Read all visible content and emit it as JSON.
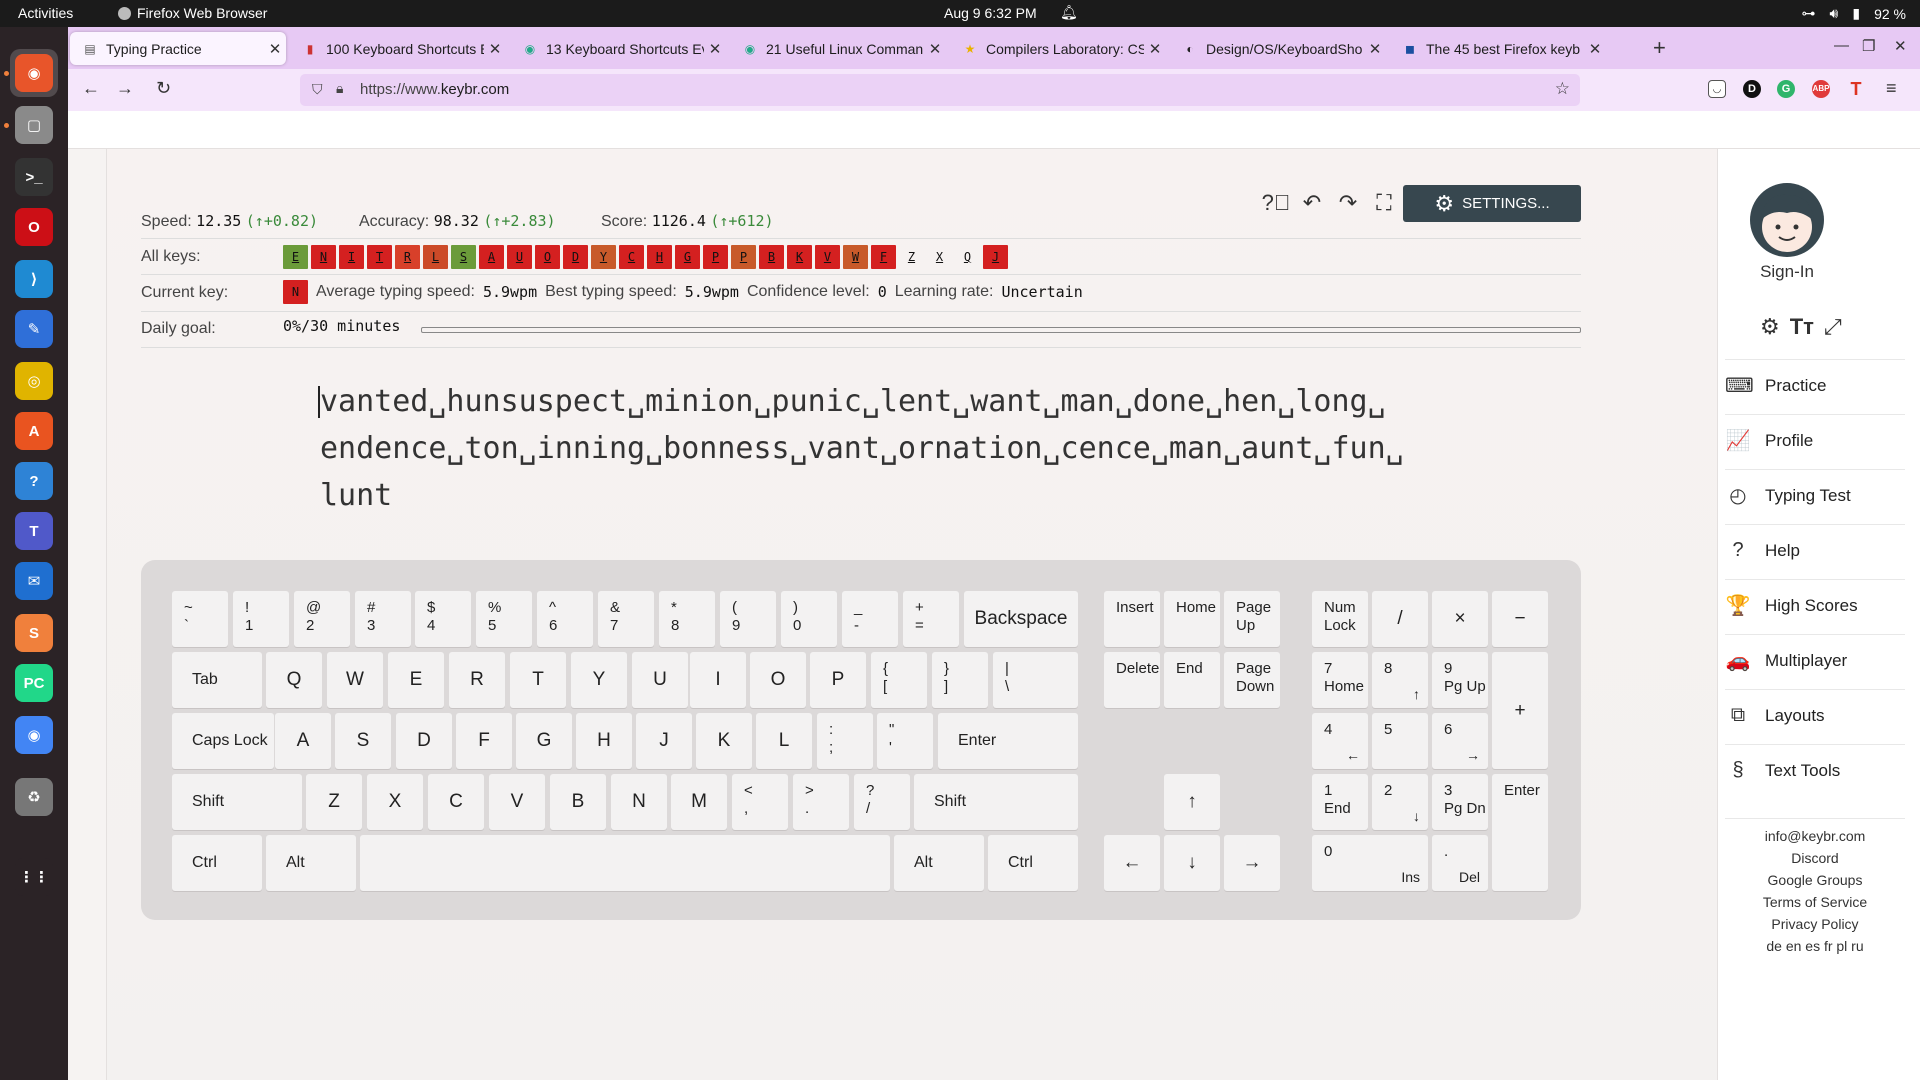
{
  "os": {
    "activities": "Activities",
    "app_name": "Firefox Web Browser",
    "clock": "Aug 9  6:32 PM",
    "battery": "92 %"
  },
  "dock": [
    "firefox-icon",
    "files-icon",
    "terminal-icon",
    "opera-icon",
    "vscode-icon",
    "text-editor-icon",
    "rhythmbox-icon",
    "app-center-icon",
    "help-icon",
    "teams-icon",
    "thunderbird-icon",
    "sublime-icon",
    "pycharm-icon",
    "chrome-icon",
    "trash-icon",
    "app-grid-icon"
  ],
  "tabs": [
    {
      "title": "Typing Practice",
      "favicon": "▤",
      "fav_color": "#555"
    },
    {
      "title": "100 Keyboard Shortcuts E",
      "favicon": "▮",
      "fav_color": "#c33"
    },
    {
      "title": "13 Keyboard Shortcuts Ev",
      "favicon": "◉",
      "fav_color": "#2a8"
    },
    {
      "title": "21 Useful Linux Comman",
      "favicon": "◉",
      "fav_color": "#2a8"
    },
    {
      "title": "Compilers Laboratory: CS",
      "favicon": "★",
      "fav_color": "#e9b200"
    },
    {
      "title": "Design/OS/KeyboardSho",
      "favicon": "◐",
      "fav_color": "#222"
    },
    {
      "title": "The 45 best Firefox keyb",
      "favicon": "◼",
      "fav_color": "#1b4fa0"
    }
  ],
  "url": {
    "prefix": "https://www.",
    "domain": "keybr.com"
  },
  "stats": {
    "speed_label": "Speed:",
    "speed": "12.35",
    "speed_delta": "(↑+0.82)",
    "accuracy_label": "Accuracy:",
    "accuracy": "98.32",
    "accuracy_delta": "(↑+2.83)",
    "score_label": "Score:",
    "score": "1126.4",
    "score_delta": "(↑+612)"
  },
  "settings_label": "SETTINGS...",
  "all_keys_label": "All keys:",
  "all_keys": [
    {
      "k": "E",
      "c": "#6b9b3a"
    },
    {
      "k": "N",
      "c": "#d42020"
    },
    {
      "k": "I",
      "c": "#d42020"
    },
    {
      "k": "T",
      "c": "#d42020"
    },
    {
      "k": "R",
      "c": "#d8402a"
    },
    {
      "k": "L",
      "c": "#cc4a28"
    },
    {
      "k": "S",
      "c": "#6b9b3a"
    },
    {
      "k": "A",
      "c": "#d42020"
    },
    {
      "k": "U",
      "c": "#d42020"
    },
    {
      "k": "O",
      "c": "#d42020"
    },
    {
      "k": "D",
      "c": "#d42020"
    },
    {
      "k": "Y",
      "c": "#c85a2a"
    },
    {
      "k": "C",
      "c": "#d42020"
    },
    {
      "k": "H",
      "c": "#d42020"
    },
    {
      "k": "G",
      "c": "#d42020"
    },
    {
      "k": "P",
      "c": "#d42020"
    },
    {
      "k": "P",
      "c": "#c85a2a"
    },
    {
      "k": "B",
      "c": "#d42020"
    },
    {
      "k": "K",
      "c": "#d42020"
    },
    {
      "k": "V",
      "c": "#d42020"
    },
    {
      "k": "W",
      "c": "#c85a2a"
    },
    {
      "k": "F",
      "c": "#d42020"
    },
    {
      "k": "Z",
      "c": ""
    },
    {
      "k": "X",
      "c": ""
    },
    {
      "k": "Q",
      "c": ""
    },
    {
      "k": "J",
      "c": "#d42020"
    }
  ],
  "current": {
    "label": "Current key:",
    "key": "N",
    "avg_label": "Average typing speed:",
    "avg": "5.9wpm",
    "best_label": "Best typing speed:",
    "best": "5.9wpm",
    "conf_label": "Confidence level:",
    "conf": "0",
    "rate_label": "Learning rate:",
    "rate": "Uncertain"
  },
  "goal": {
    "label": "Daily goal:",
    "value": "0%/30 minutes",
    "progress": 0
  },
  "practice_lines": [
    "vanted␣hunsuspect␣minion␣punic␣lent␣want␣man␣done␣hen␣long␣",
    "endence␣ton␣inning␣bonness␣vant␣ornation␣cence␣man␣aunt␣fun␣",
    "lunt"
  ],
  "keyboard": {
    "num_row": [
      [
        "~",
        "`"
      ],
      [
        "!",
        "1"
      ],
      [
        "@",
        "2"
      ],
      [
        "#",
        "3"
      ],
      [
        "$",
        "4"
      ],
      [
        "%",
        "5"
      ],
      [
        "^",
        "6"
      ],
      [
        "&",
        "7"
      ],
      [
        "*",
        "8"
      ],
      [
        "(",
        "9"
      ],
      [
        ")",
        "0"
      ],
      [
        "_",
        "-"
      ],
      [
        "+",
        "="
      ]
    ],
    "backspace": "Backspace",
    "tab": "Tab",
    "row_q": [
      "Q",
      "W",
      "E",
      "R",
      "T",
      "Y",
      "U",
      "I",
      "O",
      "P"
    ],
    "row_q_sym": [
      [
        "{",
        "["
      ],
      [
        "}",
        "]"
      ],
      [
        "|",
        "\\"
      ]
    ],
    "caps": "Caps Lock",
    "row_a": [
      "A",
      "S",
      "D",
      "F",
      "G",
      "H",
      "J",
      "K",
      "L"
    ],
    "row_a_sym": [
      [
        ":",
        ";"
      ],
      [
        "\"",
        "'"
      ]
    ],
    "enter": "Enter",
    "shift": "Shift",
    "row_z": [
      "Z",
      "X",
      "C",
      "V",
      "B",
      "N",
      "M"
    ],
    "row_z_sym": [
      [
        "<",
        ","
      ],
      [
        ">",
        "."
      ],
      [
        "?",
        "/"
      ]
    ],
    "ctrl": "Ctrl",
    "alt": "Alt",
    "nav": [
      [
        "Insert"
      ],
      [
        "Home"
      ],
      [
        "Page\nUp"
      ],
      [
        "Delete"
      ],
      [
        "End"
      ],
      [
        "Page\nDown"
      ]
    ],
    "arrows": [
      "↑",
      "←",
      "↓",
      "→"
    ],
    "numpad_top": [
      "Num\nLock",
      "/",
      "×",
      "−"
    ],
    "numpad": [
      [
        "7",
        "Home"
      ],
      [
        "8",
        "↑"
      ],
      [
        "9",
        "Pg Up"
      ],
      [
        "4",
        "←"
      ],
      [
        "5",
        ""
      ],
      [
        "6",
        "→"
      ],
      [
        "1",
        "End"
      ],
      [
        "2",
        "↓"
      ],
      [
        "3",
        "Pg Dn"
      ]
    ],
    "numpad_plus": "+",
    "numpad_enter": "Enter",
    "numpad_zero": [
      "0",
      "Ins"
    ],
    "numpad_dot": [
      ".",
      "Del"
    ]
  },
  "sidebar": {
    "signin": "Sign-In",
    "nav": [
      {
        "label": "Practice",
        "icon": "⌨"
      },
      {
        "label": "Profile",
        "icon": "📈"
      },
      {
        "label": "Typing Test",
        "icon": "◴"
      },
      {
        "label": "Help",
        "icon": "?"
      },
      {
        "label": "High Scores",
        "icon": "🏆"
      },
      {
        "label": "Multiplayer",
        "icon": "🚗"
      },
      {
        "label": "Layouts",
        "icon": "⧉"
      },
      {
        "label": "Text Tools",
        "icon": "§"
      }
    ],
    "links": [
      "info@keybr.com",
      "Discord",
      "Google Groups",
      "Terms of Service",
      "Privacy Policy",
      "de en es fr pl ru"
    ]
  }
}
